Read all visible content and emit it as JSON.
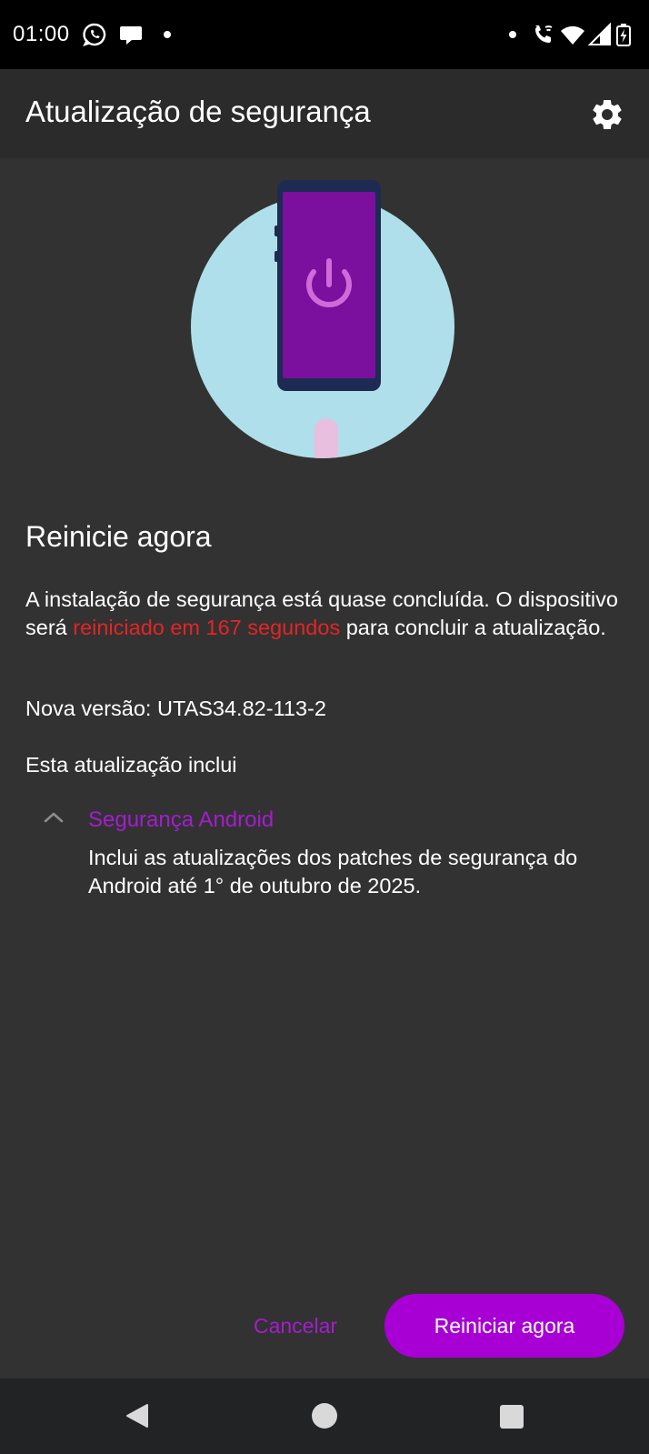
{
  "status_bar": {
    "time": "01:00",
    "left_icons": [
      "whatsapp-icon",
      "chat-bubble-icon",
      "notification-dot-icon"
    ],
    "right_icons": [
      "notification-dot-icon",
      "wifi-calling-icon",
      "wifi-icon",
      "signal-icon",
      "battery-charging-icon"
    ]
  },
  "app_bar": {
    "title": "Atualização de segurança",
    "settings_icon": "gear-icon"
  },
  "content": {
    "heading": "Reinicie agora",
    "body_prefix": "A instalação de segurança está quase concluída. O dispositivo será ",
    "body_highlight": "reiniciado em 167 segundos",
    "body_suffix": " para concluir a atualização.",
    "version_label": "Nova versão: ",
    "version_value": "UTAS34.82-113-2",
    "includes_label": "Esta atualização inclui",
    "section": {
      "title": "Segurança Android",
      "description": "Inclui as atualizações dos patches de segurança do Android até 1° de outubro de 2025.",
      "expanded": true
    }
  },
  "buttons": {
    "cancel_label": "Cancelar",
    "restart_label": "Reiniciar agora"
  },
  "nav_bar": {
    "icons": [
      "back-icon",
      "home-icon",
      "recents-icon"
    ]
  },
  "colors": {
    "background": "#323232",
    "app_bar": "#2b2b2b",
    "accent": "#a800d4",
    "link_text": "#a51dce",
    "highlight_red": "#e52424",
    "phone_screen": "#7b0f9e",
    "circle": "#afdfea"
  }
}
